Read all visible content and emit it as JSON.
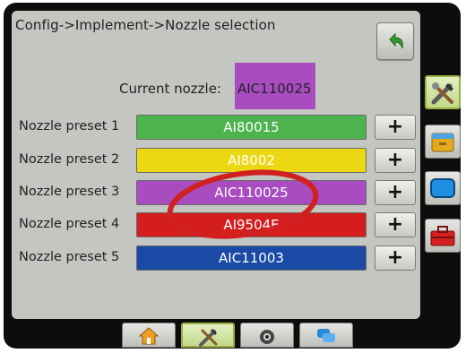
{
  "header": {
    "breadcrumb": "Config->Implement->Nozzle selection",
    "back_icon": "back-arrow-icon"
  },
  "current_nozzle": {
    "label": "Current nozzle:",
    "value": "AIC110025",
    "color": "#a84cbf"
  },
  "presets": [
    {
      "label": "Nozzle preset 1",
      "value": "AI80015",
      "color": "#4db34d",
      "add_label": "+"
    },
    {
      "label": "Nozzle preset 2",
      "value": "AI8002",
      "color": "#ecd812",
      "add_label": "+"
    },
    {
      "label": "Nozzle preset 3",
      "value": "AIC110025",
      "color": "#a84cbf",
      "add_label": "+"
    },
    {
      "label": "Nozzle preset 4",
      "value": "AI9504E",
      "color": "#d41e1e",
      "add_label": "+"
    },
    {
      "label": "Nozzle preset 5",
      "value": "AIC11003",
      "color": "#1a4aa6",
      "add_label": "+"
    }
  ],
  "sidebar": {
    "items": [
      {
        "icon": "tools-icon",
        "active": true
      },
      {
        "icon": "storage-drawer-icon",
        "active": false
      },
      {
        "icon": "display-icon",
        "active": false
      },
      {
        "icon": "toolbox-icon",
        "active": false
      }
    ]
  },
  "bottom_tabs": [
    {
      "icon": "home-icon",
      "active": false
    },
    {
      "icon": "tools-icon",
      "active": true
    },
    {
      "icon": "camera-icon",
      "active": false
    },
    {
      "icon": "chat-icon",
      "active": false
    }
  ],
  "colors": {
    "annotation": "#d22020",
    "active_tab": "#9ab03a"
  }
}
